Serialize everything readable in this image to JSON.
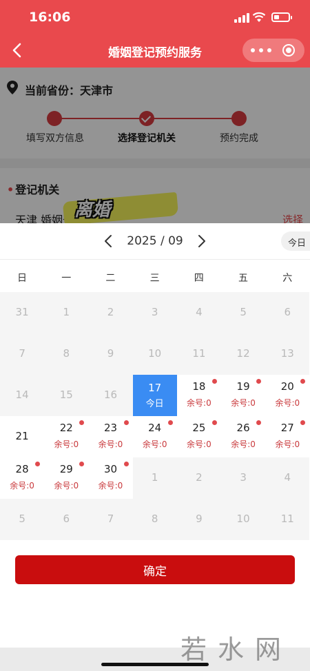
{
  "status": {
    "time": "16:06"
  },
  "nav": {
    "title": "婚姻登记预约服务",
    "back_icon": "chevron-left-icon",
    "more_icon": "more-dots-icon",
    "close_icon": "target-close-icon"
  },
  "province": {
    "text": "当前省份：天津市"
  },
  "steps": [
    {
      "label": "填写双方信息",
      "state": "done"
    },
    {
      "label": "选择登记机关",
      "state": "current"
    },
    {
      "label": "预约完成",
      "state": "pending"
    }
  ],
  "registry": {
    "label": "登记机关",
    "required_mark": "•",
    "office": "天津    婚姻登记处",
    "choose": "选择"
  },
  "sticker": {
    "text": "离婚"
  },
  "calendar": {
    "prev_icon": "chevron-left-icon",
    "next_icon": "chevron-right-icon",
    "month": "2025 / 09",
    "today_btn": "今日",
    "weekdays": [
      "日",
      "一",
      "二",
      "三",
      "四",
      "五",
      "六"
    ],
    "rows": [
      [
        {
          "d": "31",
          "m": 1
        },
        {
          "d": "1",
          "m": 1
        },
        {
          "d": "2",
          "m": 1
        },
        {
          "d": "3",
          "m": 1
        },
        {
          "d": "4",
          "m": 1
        },
        {
          "d": "5",
          "m": 1
        },
        {
          "d": "6",
          "m": 1
        }
      ],
      [
        {
          "d": "7",
          "m": 1
        },
        {
          "d": "8",
          "m": 1
        },
        {
          "d": "9",
          "m": 1
        },
        {
          "d": "10",
          "m": 1
        },
        {
          "d": "11",
          "m": 1
        },
        {
          "d": "12",
          "m": 1
        },
        {
          "d": "13",
          "m": 1
        }
      ],
      [
        {
          "d": "14",
          "m": 1
        },
        {
          "d": "15",
          "m": 1
        },
        {
          "d": "16",
          "m": 1
        },
        {
          "d": "17",
          "sel": 1,
          "sub": "今日"
        },
        {
          "d": "18",
          "sub": "余号:0",
          "dot": 1
        },
        {
          "d": "19",
          "sub": "余号:0",
          "dot": 1
        },
        {
          "d": "20",
          "sub": "余号:0",
          "dot": 1
        }
      ],
      [
        {
          "d": "21",
          "dark": 1
        },
        {
          "d": "22",
          "sub": "余号:0",
          "dot": 1
        },
        {
          "d": "23",
          "sub": "余号:0",
          "dot": 1
        },
        {
          "d": "24",
          "sub": "余号:0",
          "dot": 1
        },
        {
          "d": "25",
          "sub": "余号:0",
          "dot": 1
        },
        {
          "d": "26",
          "sub": "余号:0",
          "dot": 1
        },
        {
          "d": "27",
          "sub": "余号:0",
          "dot": 1
        }
      ],
      [
        {
          "d": "28",
          "sub": "余号:0",
          "dot": 1
        },
        {
          "d": "29",
          "sub": "余号:0",
          "dot": 1
        },
        {
          "d": "30",
          "sub": "余号:0",
          "dot": 1
        },
        {
          "d": "1",
          "m": 1
        },
        {
          "d": "2",
          "m": 1
        },
        {
          "d": "3",
          "m": 1
        },
        {
          "d": "4",
          "m": 1
        }
      ],
      [
        {
          "d": "5",
          "m": 1
        },
        {
          "d": "6",
          "m": 1
        },
        {
          "d": "7",
          "m": 1
        },
        {
          "d": "8",
          "m": 1
        },
        {
          "d": "9",
          "m": 1
        },
        {
          "d": "10",
          "m": 1
        },
        {
          "d": "11",
          "m": 1
        }
      ]
    ],
    "confirm": "确定"
  },
  "watermark": {
    "text": "若水网"
  },
  "colors": {
    "brand": "#e9494d",
    "confirm": "#c90d0e",
    "selected": "#3a8cf3"
  }
}
